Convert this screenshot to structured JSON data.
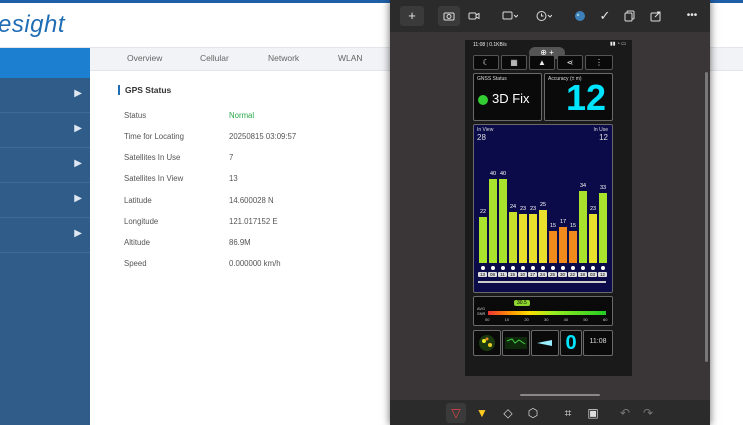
{
  "app": {
    "logo_text": "esight"
  },
  "tabs": [
    "Overview",
    "Cellular",
    "Network",
    "WLAN"
  ],
  "gps": {
    "title": "GPS Status",
    "rows": [
      {
        "label": "Status",
        "value": "Normal"
      },
      {
        "label": "Time for Locating",
        "value": "20250815 03:09:57"
      },
      {
        "label": "Satellites In Use",
        "value": "7"
      },
      {
        "label": "Satellites In View",
        "value": "13"
      },
      {
        "label": "Latitude",
        "value": "14.600028 N"
      },
      {
        "label": "Longitude",
        "value": "121.017152 E"
      },
      {
        "label": "Altitude",
        "value": "86.9M"
      },
      {
        "label": "Speed",
        "value": "0.000000 km/h"
      }
    ],
    "status_color": "#2aa84a"
  },
  "snip": {
    "toolbar": {
      "new": "+",
      "screenshot_icon": "camera-icon",
      "record_icon": "video-icon",
      "shape_icon": "rectangle-icon",
      "delay_icon": "clock-icon",
      "more": "•••"
    },
    "bottom_icons": [
      "pen-icon",
      "highlighter-icon",
      "eraser-icon",
      "shape-icon",
      "crop-icon",
      "text-action-icon",
      "undo-icon",
      "redo-icon"
    ]
  },
  "phone": {
    "status_time": "11:08 | 0.1KB/s",
    "gnss_label": "GNSS Status",
    "fix_text": "3D Fix",
    "accuracy_label": "Accuracy (± m)",
    "accuracy_value": "12",
    "in_view_label": "In View",
    "in_view_value": "28",
    "in_use_label": "In Use",
    "in_use_value": "12",
    "bar_values": [
      22,
      40,
      40,
      24,
      23,
      23,
      25,
      15,
      17,
      15,
      34,
      23,
      33
    ],
    "bar_colors": [
      "#a8e22c",
      "#a8e22c",
      "#a8e22c",
      "#c8e02c",
      "#e8e02c",
      "#e8e02c",
      "#e8e02c",
      "#f08a1c",
      "#f08a1c",
      "#f08a1c",
      "#a8e22c",
      "#e8e02c",
      "#a8e22c"
    ],
    "sat_ids": [
      "13",
      "08",
      "11",
      "15",
      "10",
      "17",
      "24",
      "25",
      "30",
      "22",
      "18",
      "03",
      "12"
    ],
    "snr_value": "30.5",
    "snr_ticks": [
      "00",
      "10",
      "20",
      "30",
      "40",
      "50",
      "60"
    ],
    "bottom_value": "0",
    "clock": "11:08",
    "accent": "#00e5ff",
    "fix_dot": "#33cc33"
  }
}
